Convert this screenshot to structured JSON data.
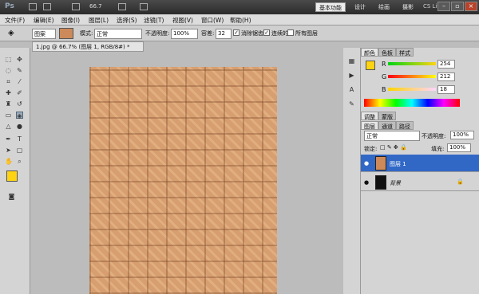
{
  "app": {
    "logo": "Ps",
    "zoom": "66.7"
  },
  "workspaces": [
    "基本功能",
    "设计",
    "绘画",
    "摄影"
  ],
  "cs_live": "CS Live",
  "menu": [
    "文件(F)",
    "编辑(E)",
    "图像(I)",
    "图层(L)",
    "选择(S)",
    "滤镜(T)",
    "视图(V)",
    "窗口(W)",
    "帮助(H)"
  ],
  "options": {
    "fill_source": "图案",
    "mode_label": "模式:",
    "mode_value": "正常",
    "opacity_label": "不透明度:",
    "opacity_value": "100%",
    "tolerance_label": "容差:",
    "tolerance_value": "32",
    "antialias": "消除锯齿",
    "contiguous": "连续的",
    "all_layers": "所有图层"
  },
  "document": {
    "tab": "1.jpg @ 66.7% (图层 1, RGB/8#) *"
  },
  "color_panel": {
    "tabs": [
      "颜色",
      "色板",
      "样式"
    ],
    "r_label": "R",
    "g_label": "G",
    "b_label": "B",
    "r": "254",
    "g": "212",
    "b": "18",
    "fg_color": "#fed412"
  },
  "adjust_tabs": [
    "调整",
    "蒙版"
  ],
  "layers_panel": {
    "tabs": [
      "图层",
      "通道",
      "路径"
    ],
    "blend": "正常",
    "opacity_label": "不透明度:",
    "opacity": "100%",
    "lock_label": "锁定:",
    "fill_label": "填充:",
    "fill": "100%",
    "layers": [
      {
        "name": "图层 1",
        "selected": true
      },
      {
        "name": "背景",
        "selected": false
      }
    ]
  },
  "colors": {
    "accent": "#3168c6",
    "swatch": "#cc8a5a"
  }
}
